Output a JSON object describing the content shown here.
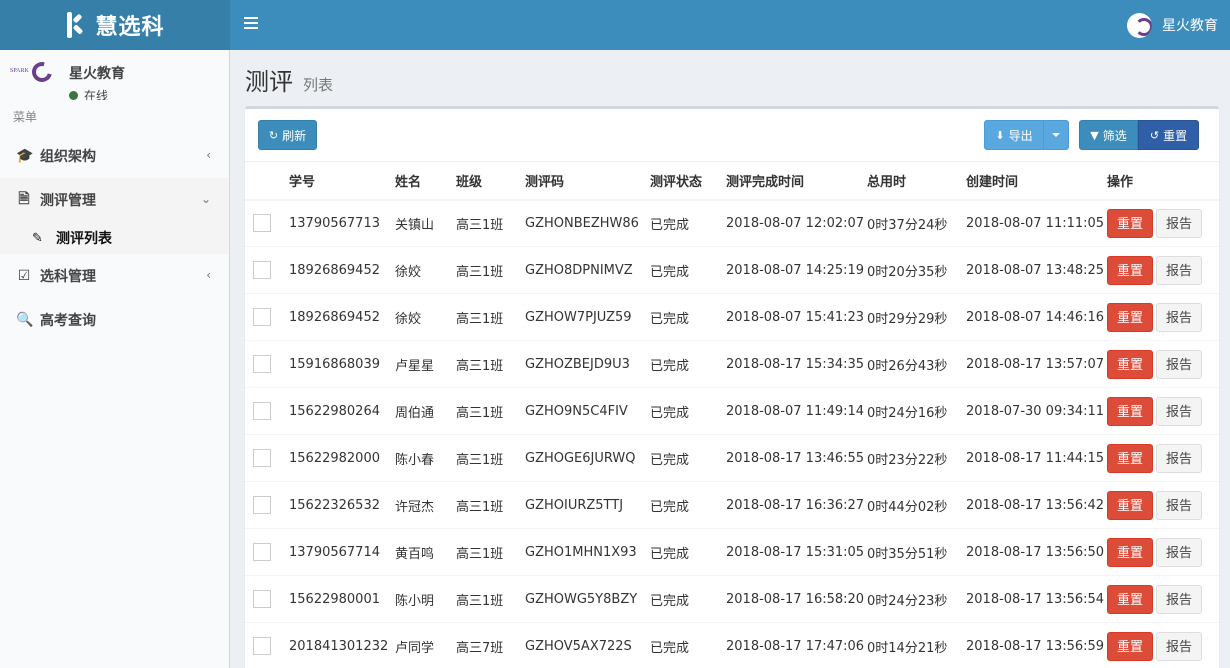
{
  "header": {
    "logo_text": "慧选科",
    "user_name": "星火教育"
  },
  "sidebar": {
    "user_name": "星火教育",
    "user_status": "在线",
    "avatar_text": "SPARK",
    "menu_header": "菜单",
    "items": [
      {
        "label": "组织架构",
        "icon": "graduation-cap-icon"
      },
      {
        "label": "测评管理",
        "icon": "document-icon"
      },
      {
        "label": "测评列表",
        "icon": "pencil-icon"
      },
      {
        "label": "选科管理",
        "icon": "check-square-icon"
      },
      {
        "label": "高考查询",
        "icon": "search-icon"
      }
    ]
  },
  "page": {
    "title": "测评",
    "subtitle": "列表"
  },
  "toolbar": {
    "refresh": "刷新",
    "export": "导出",
    "filter": "筛选",
    "reset": "重置"
  },
  "table": {
    "headers": [
      "学号",
      "姓名",
      "班级",
      "测评码",
      "测评状态",
      "测评完成时间",
      "总用时",
      "创建时间",
      "操作"
    ],
    "reset_label": "重置",
    "report_label": "报告",
    "rows": [
      {
        "id": "13790567713",
        "name": "关镇山",
        "class": "高三1班",
        "code": "GZHONBEZHW86",
        "status": "已完成",
        "done": "2018-08-07 12:02:07",
        "total": "0时37分24秒",
        "created": "2018-08-07 11:11:05"
      },
      {
        "id": "18926869452",
        "name": "徐姣",
        "class": "高三1班",
        "code": "GZHO8DPNIMVZ",
        "status": "已完成",
        "done": "2018-08-07 14:25:19",
        "total": "0时20分35秒",
        "created": "2018-08-07 13:48:25"
      },
      {
        "id": "18926869452",
        "name": "徐姣",
        "class": "高三1班",
        "code": "GZHOW7PJUZ59",
        "status": "已完成",
        "done": "2018-08-07 15:41:23",
        "total": "0时29分29秒",
        "created": "2018-08-07 14:46:16"
      },
      {
        "id": "15916868039",
        "name": "卢星星",
        "class": "高三1班",
        "code": "GZHOZBEJD9U3",
        "status": "已完成",
        "done": "2018-08-17 15:34:35",
        "total": "0时26分43秒",
        "created": "2018-08-17 13:57:07"
      },
      {
        "id": "15622980264",
        "name": "周伯通",
        "class": "高三1班",
        "code": "GZHO9N5C4FIV",
        "status": "已完成",
        "done": "2018-08-07 11:49:14",
        "total": "0时24分16秒",
        "created": "2018-07-30 09:34:11"
      },
      {
        "id": "15622982000",
        "name": "陈小春",
        "class": "高三1班",
        "code": "GZHOGE6JURWQ",
        "status": "已完成",
        "done": "2018-08-17 13:46:55",
        "total": "0时23分22秒",
        "created": "2018-08-17 11:44:15"
      },
      {
        "id": "15622326532",
        "name": "许冠杰",
        "class": "高三1班",
        "code": "GZHOIURZ5TTJ",
        "status": "已完成",
        "done": "2018-08-17 16:36:27",
        "total": "0时44分02秒",
        "created": "2018-08-17 13:56:42"
      },
      {
        "id": "13790567714",
        "name": "黄百鸣",
        "class": "高三1班",
        "code": "GZHO1MHN1X93",
        "status": "已完成",
        "done": "2018-08-17 15:31:05",
        "total": "0时35分51秒",
        "created": "2018-08-17 13:56:50"
      },
      {
        "id": "15622980001",
        "name": "陈小明",
        "class": "高三1班",
        "code": "GZHOWG5Y8BZY",
        "status": "已完成",
        "done": "2018-08-17 16:58:20",
        "total": "0时24分23秒",
        "created": "2018-08-17 13:56:54"
      },
      {
        "id": "201841301232",
        "name": "卢同学",
        "class": "高三7班",
        "code": "GZHOV5AX722S",
        "status": "已完成",
        "done": "2018-08-17 17:47:06",
        "total": "0时14分21秒",
        "created": "2018-08-17 13:56:59"
      }
    ]
  },
  "colors": {
    "header": "#3c8dbc",
    "logo_bg": "#367fa9",
    "danger": "#dd4b39",
    "export": "#5aa8e0",
    "reset_dark": "#2f5fa6"
  }
}
